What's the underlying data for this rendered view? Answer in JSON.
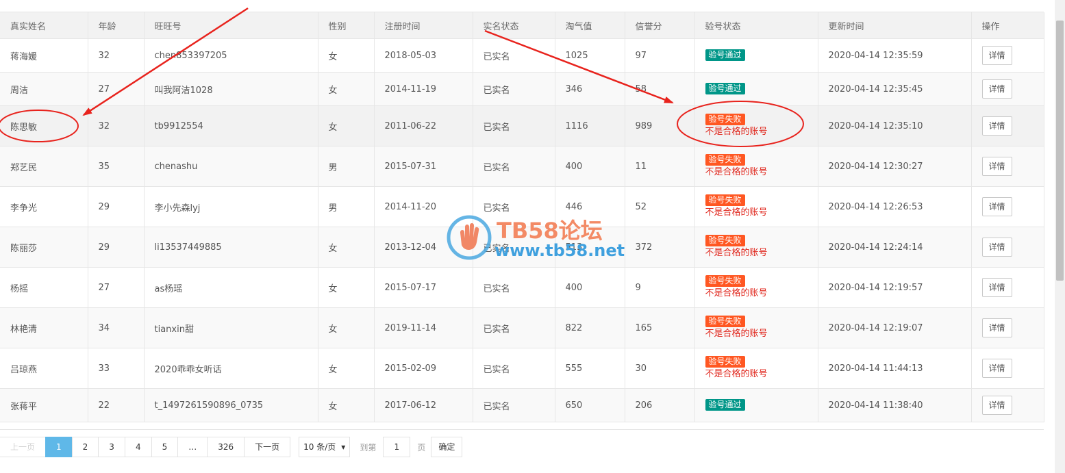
{
  "table": {
    "columns": [
      "真实姓名",
      "年龄",
      "旺旺号",
      "性别",
      "注册时间",
      "实名状态",
      "淘气值",
      "信誉分",
      "验号状态",
      "更新时间",
      "操作"
    ],
    "rows": [
      {
        "name": "蒋海媛",
        "age": "32",
        "wangwang": "chen853397205",
        "gender": "女",
        "reg_time": "2018-05-03",
        "real_name": "已实名",
        "taoqi": "1025",
        "credit": "97",
        "status": "验号通过",
        "status_note": "",
        "updated": "2020-04-14 12:35:59",
        "action": "详情"
      },
      {
        "name": "周洁",
        "age": "27",
        "wangwang": "叫我阿洁1028",
        "gender": "女",
        "reg_time": "2014-11-19",
        "real_name": "已实名",
        "taoqi": "346",
        "credit": "58",
        "status": "验号通过",
        "status_note": "",
        "updated": "2020-04-14 12:35:45",
        "action": "详情"
      },
      {
        "name": "陈思敏",
        "age": "32",
        "wangwang": "tb9912554",
        "gender": "女",
        "reg_time": "2011-06-22",
        "real_name": "已实名",
        "taoqi": "1116",
        "credit": "989",
        "status": "验号失败",
        "status_note": "不是合格的账号",
        "updated": "2020-04-14 12:35:10",
        "action": "详情"
      },
      {
        "name": "郑艺民",
        "age": "35",
        "wangwang": "chenashu",
        "gender": "男",
        "reg_time": "2015-07-31",
        "real_name": "已实名",
        "taoqi": "400",
        "credit": "11",
        "status": "验号失败",
        "status_note": "不是合格的账号",
        "updated": "2020-04-14 12:30:27",
        "action": "详情"
      },
      {
        "name": "李争光",
        "age": "29",
        "wangwang": "李小先森lyj",
        "gender": "男",
        "reg_time": "2014-11-20",
        "real_name": "已实名",
        "taoqi": "446",
        "credit": "52",
        "status": "验号失败",
        "status_note": "不是合格的账号",
        "updated": "2020-04-14 12:26:53",
        "action": "详情"
      },
      {
        "name": "陈丽莎",
        "age": "29",
        "wangwang": "li13537449885",
        "gender": "女",
        "reg_time": "2013-12-04",
        "real_name": "已实名",
        "taoqi": "513",
        "credit": "372",
        "status": "验号失败",
        "status_note": "不是合格的账号",
        "updated": "2020-04-14 12:24:14",
        "action": "详情"
      },
      {
        "name": "杨摇",
        "age": "27",
        "wangwang": "as杨瑶",
        "gender": "女",
        "reg_time": "2015-07-17",
        "real_name": "已实名",
        "taoqi": "400",
        "credit": "9",
        "status": "验号失败",
        "status_note": "不是合格的账号",
        "updated": "2020-04-14 12:19:57",
        "action": "详情"
      },
      {
        "name": "林艳清",
        "age": "34",
        "wangwang": "tianxin甜",
        "gender": "女",
        "reg_time": "2019-11-14",
        "real_name": "已实名",
        "taoqi": "822",
        "credit": "165",
        "status": "验号失败",
        "status_note": "不是合格的账号",
        "updated": "2020-04-14 12:19:07",
        "action": "详情"
      },
      {
        "name": "吕琼燕",
        "age": "33",
        "wangwang": "2020乖乖女听话",
        "gender": "女",
        "reg_time": "2015-02-09",
        "real_name": "已实名",
        "taoqi": "555",
        "credit": "30",
        "status": "验号失败",
        "status_note": "不是合格的账号",
        "updated": "2020-04-14 11:44:13",
        "action": "详情"
      },
      {
        "name": "张蒋平",
        "age": "22",
        "wangwang": "t_1497261590896_0735",
        "gender": "女",
        "reg_time": "2017-06-12",
        "real_name": "已实名",
        "taoqi": "650",
        "credit": "206",
        "status": "验号通过",
        "status_note": "",
        "updated": "2020-04-14 11:38:40",
        "action": "详情"
      }
    ]
  },
  "pagination": {
    "prev": "上一页",
    "pages": [
      "1",
      "2",
      "3",
      "4",
      "5",
      "…",
      "326"
    ],
    "current": "1",
    "next": "下一页",
    "page_size": "10 条/页",
    "goto_label": "到第",
    "goto_value": "1",
    "page_unit": "页",
    "confirm": "确定"
  },
  "watermark": {
    "title": "TB58论坛",
    "url": "www.tb58.net"
  },
  "colors": {
    "pass": "#009688",
    "fail": "#ff5722",
    "fail_text": "#e0251b",
    "annotation": "#e8231d",
    "active_page": "#5fb8e8"
  }
}
